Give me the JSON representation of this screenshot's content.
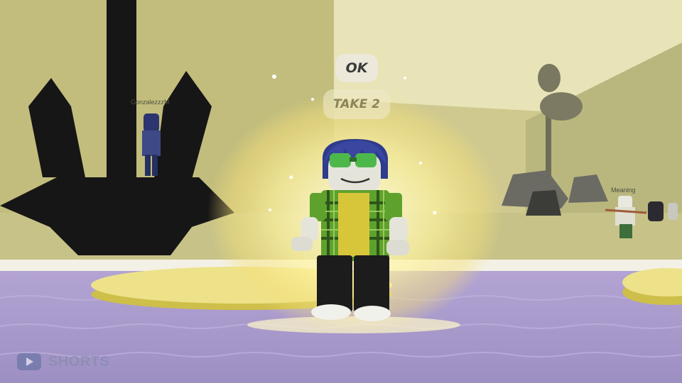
{
  "speech_bubbles": {
    "ok_label": "OK",
    "take2_label": "TAKE 2"
  },
  "players": {
    "left_name": "GonzalezzzM",
    "right_name": "Meaning"
  },
  "watermark": {
    "icon": "youtube-play-icon",
    "text": "SHORTS"
  },
  "colors": {
    "sky": "#d7d19c",
    "floor": "#a796c5",
    "platform": "#e6dc76",
    "aura": "#fff6b0",
    "shirt_plaid": "#5fa12d",
    "hair": "#2f3b8c"
  }
}
